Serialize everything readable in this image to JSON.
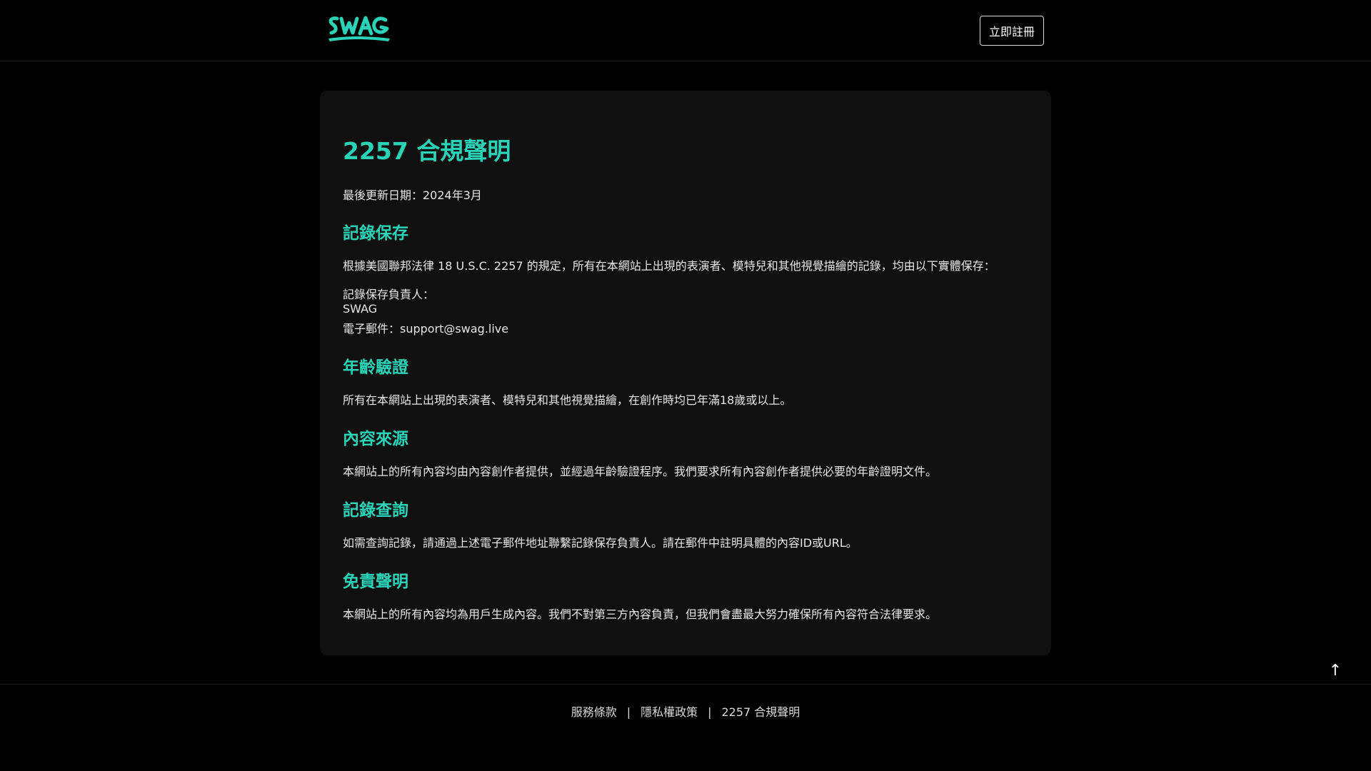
{
  "header": {
    "logo_text": "SWAG",
    "register_label": "立即註冊"
  },
  "main": {
    "title": "2257 合規聲明",
    "updated": "最後更新日期：2024年3月",
    "sections": [
      {
        "title": "記錄保存",
        "text": "根據美國聯邦法律 18 U.S.C. 2257 的規定，所有在本網站上出現的表演者、模特兒和其他視覺描繪的記錄，均由以下實體保存："
      },
      {
        "title": "年齡驗證",
        "text": "所有在本網站上出現的表演者、模特兒和其他視覺描繪，在創作時均已年滿18歲或以上。"
      },
      {
        "title": "內容來源",
        "text": "本網站上的所有內容均由內容創作者提供，並經過年齡驗證程序。我們要求所有內容創作者提供必要的年齡證明文件。"
      },
      {
        "title": "記錄查詢",
        "text": "如需查詢記錄，請通過上述電子郵件地址聯繫記錄保存負責人。請在郵件中註明具體的內容ID或URL。"
      },
      {
        "title": "免責聲明",
        "text": "本網站上的所有內容均為用戶生成內容。我們不對第三方內容負責，但我們會盡最大努力確保所有內容符合法律要求。"
      }
    ],
    "custodian": {
      "label": "記錄保存負責人：",
      "name": "SWAG",
      "email": "電子郵件：support@swag.live"
    }
  },
  "footer": {
    "links": [
      "服務條款",
      "隱私權政策",
      "2257 合規聲明"
    ],
    "separator": "|"
  },
  "back_to_top": "↑",
  "colors": {
    "accent": "#2ad3b8",
    "background": "#000000",
    "card": "#101010"
  }
}
